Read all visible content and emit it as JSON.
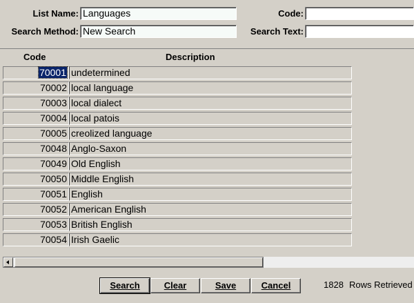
{
  "filters": {
    "list_name_label": "List Name:",
    "list_name_value": "Languages",
    "code_label": "Code:",
    "code_value": "",
    "search_method_label": "Search Method:",
    "search_method_value": "New Search",
    "search_text_label": "Search Text:",
    "search_text_value": ""
  },
  "grid": {
    "columns": [
      "Code",
      "Description"
    ],
    "rows": [
      {
        "code": "70001",
        "description": "undetermined",
        "selected": true
      },
      {
        "code": "70002",
        "description": "local language"
      },
      {
        "code": "70003",
        "description": "local dialect"
      },
      {
        "code": "70004",
        "description": "local patois"
      },
      {
        "code": "70005",
        "description": "creolized language"
      },
      {
        "code": "70048",
        "description": "Anglo-Saxon"
      },
      {
        "code": "70049",
        "description": "Old English"
      },
      {
        "code": "70050",
        "description": "Middle English"
      },
      {
        "code": "70051",
        "description": "English"
      },
      {
        "code": "70052",
        "description": "American English"
      },
      {
        "code": "70053",
        "description": "British English"
      },
      {
        "code": "70054",
        "description": "Irish Gaelic"
      }
    ]
  },
  "buttons": {
    "search": "Search",
    "clear": "Clear",
    "save": "Save",
    "cancel": "Cancel"
  },
  "status": {
    "count": "1828",
    "text": "Rows Retrieved"
  },
  "icons": {
    "scroll_left": "arrow-left-icon"
  }
}
